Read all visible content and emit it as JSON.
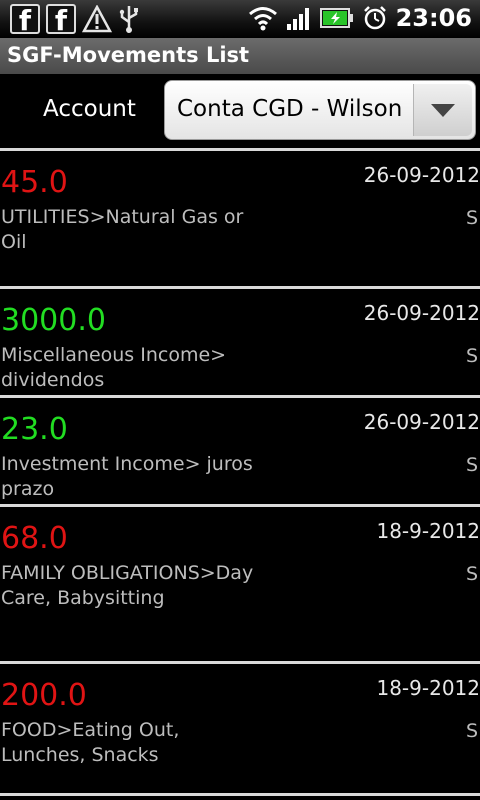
{
  "status_bar": {
    "time": "23:06",
    "icons": [
      "facebook-icon",
      "facebook-icon",
      "warning-icon",
      "usb-icon",
      "wifi-icon",
      "signal-icon",
      "battery-charging-icon",
      "alarm-icon"
    ]
  },
  "app": {
    "title": "SGF-Movements List"
  },
  "account": {
    "label": "Account",
    "selected": "Conta CGD - Wilson"
  },
  "movements": [
    {
      "amount": "45.0",
      "date": "26-09-2012",
      "category": "UTILITIES>Natural Gas or Oil",
      "flag": "S",
      "color": "#e01414"
    },
    {
      "amount": "3000.0",
      "date": "26-09-2012",
      "category": "Miscellaneous Income> dividendos",
      "flag": "S",
      "color": "#22dd22"
    },
    {
      "amount": "23.0",
      "date": "26-09-2012",
      "category": "Investment Income> juros prazo",
      "flag": "S",
      "color": "#22dd22"
    },
    {
      "amount": "68.0",
      "date": "18-9-2012",
      "category": "FAMILY OBLIGATIONS>Day Care, Babysitting",
      "flag": "S",
      "color": "#e01414"
    },
    {
      "amount": "200.0",
      "date": "18-9-2012",
      "category": "FOOD>Eating Out, Lunches, Snacks",
      "flag": "S",
      "color": "#e01414"
    }
  ]
}
